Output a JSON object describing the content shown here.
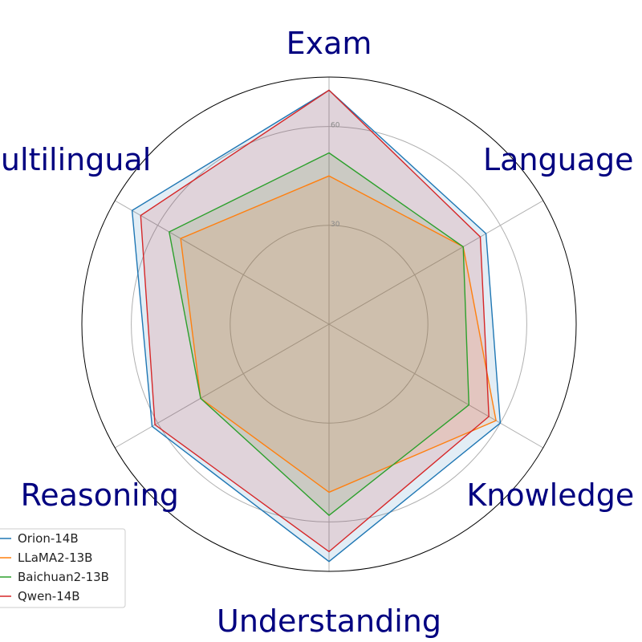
{
  "chart_data": {
    "type": "radar",
    "categories": [
      "Exam",
      "Language",
      "Knowledge",
      "Understanding",
      "Reasoning",
      "Multilingual"
    ],
    "r_ticks": [
      30,
      60
    ],
    "r_max": 75,
    "grid": true,
    "legend_position": "bottom-left",
    "series": [
      {
        "name": "Orion-14B",
        "color": "#1f77b4",
        "values": [
          71.0,
          55.0,
          60.0,
          72.0,
          62.0,
          69.0
        ]
      },
      {
        "name": "LLaMA2-13B",
        "color": "#ff7f0e",
        "values": [
          45.0,
          47.0,
          58.5,
          51.0,
          45.0,
          52.0
        ]
      },
      {
        "name": "Baichuan2-13B",
        "color": "#2ca02c",
        "values": [
          52.0,
          47.0,
          49.0,
          58.0,
          45.0,
          56.0
        ]
      },
      {
        "name": "Qwen-14B",
        "color": "#d62728",
        "values": [
          71.0,
          53.0,
          56.0,
          69.0,
          61.0,
          66.0
        ]
      }
    ],
    "fill_color": "#c8a0d0",
    "label_color": "#000080"
  }
}
